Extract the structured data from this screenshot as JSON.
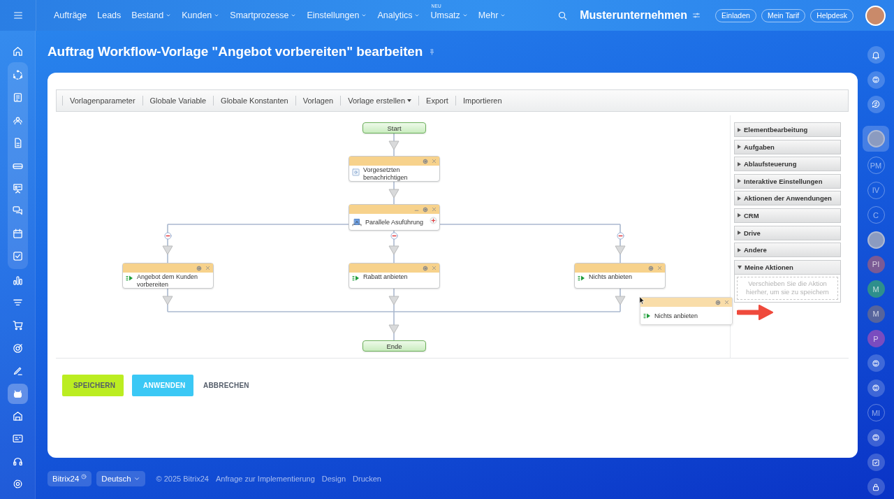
{
  "top_nav": {
    "items": [
      {
        "label": "Aufträge",
        "dropdown": false
      },
      {
        "label": "Leads",
        "dropdown": false
      },
      {
        "label": "Bestand",
        "dropdown": true
      },
      {
        "label": "Kunden",
        "dropdown": true
      },
      {
        "label": "Smartprozesse",
        "dropdown": true
      },
      {
        "label": "Einstellungen",
        "dropdown": true
      },
      {
        "label": "Analytics",
        "dropdown": true
      },
      {
        "label": "Umsatz",
        "dropdown": true,
        "badge": "NEU"
      },
      {
        "label": "Mehr",
        "dropdown": true
      }
    ],
    "company": "Musterunternehmen",
    "buttons": [
      "Einladen",
      "Mein Tarif",
      "Helpdesk"
    ]
  },
  "left_sidebar": {
    "items": [
      {
        "selected": false
      },
      {
        "selected": false
      },
      {
        "selected": false
      },
      {
        "selected": false
      },
      {
        "selected": false
      },
      {
        "selected": false
      },
      {
        "selected": false
      },
      {
        "selected": false
      },
      {
        "selected": false
      },
      {
        "selected": false
      },
      {
        "selected": false
      },
      {
        "selected": false
      },
      {
        "selected": false
      },
      {
        "selected": false
      },
      {
        "selected": false
      },
      {
        "selected": true
      },
      {
        "selected": false
      },
      {
        "selected": false
      },
      {
        "selected": false
      },
      {
        "selected": false
      }
    ]
  },
  "page_title": "Auftrag Workflow-Vorlage \"Angebot vorbereiten\" bearbeiten",
  "toolbar": [
    {
      "label": "Vorlagenparameter",
      "dropdown": false
    },
    {
      "label": "Globale Variable",
      "dropdown": false
    },
    {
      "label": "Globale Konstanten",
      "dropdown": false
    },
    {
      "label": "Vorlagen",
      "dropdown": false
    },
    {
      "label": "Vorlage erstellen",
      "dropdown": true
    },
    {
      "label": "Export",
      "dropdown": false
    },
    {
      "label": "Importieren",
      "dropdown": false
    }
  ],
  "diagram": {
    "nodes": [
      {
        "kind": "terminal",
        "label": "Start"
      },
      {
        "kind": "notify",
        "label": "Vorgesetzten benachrichtigen"
      },
      {
        "kind": "parallel",
        "label": "Parallele Asuführung"
      },
      {
        "kind": "action",
        "label": "Angebot dem Kunden vorbereiten"
      },
      {
        "kind": "action",
        "label": "Rabatt anbieten"
      },
      {
        "kind": "action",
        "label": "Nichts anbieten"
      },
      {
        "kind": "terminal",
        "label": "Ende"
      }
    ]
  },
  "palette": {
    "sections": [
      {
        "label": "Elementbearbeitung",
        "expanded": false
      },
      {
        "label": "Aufgaben",
        "expanded": false
      },
      {
        "label": "Ablaufsteuerung",
        "expanded": false
      },
      {
        "label": "Interaktive Einstellungen",
        "expanded": false
      },
      {
        "label": "Aktionen der Anwendungen",
        "expanded": false
      },
      {
        "label": "CRM",
        "expanded": false
      },
      {
        "label": "Drive",
        "expanded": false
      },
      {
        "label": "Andere",
        "expanded": false
      },
      {
        "label": "Meine Aktionen",
        "expanded": true,
        "hint": "Verschieben Sie die Aktion hierher, um sie zu speichern"
      }
    ]
  },
  "drag_item": {
    "label": "Nichts anbieten"
  },
  "buttons": [
    {
      "label": "SPEICHERN",
      "kind": "save"
    },
    {
      "label": "ANWENDEN",
      "kind": "apply"
    },
    {
      "label": "ABBRECHEN",
      "kind": "cancel"
    }
  ],
  "footer": {
    "brand": "Bitrix24",
    "language": "Deutsch",
    "links": [
      "© 2025 Bitrix24",
      "Anfrage zur Implementierung",
      "Design",
      "Drucken"
    ]
  },
  "right_sidebar": {
    "items": [
      {
        "kind": "icon",
        "selected": false
      },
      {
        "kind": "icon",
        "selected": false
      },
      {
        "kind": "icon",
        "selected": false
      },
      {
        "kind": "avatar",
        "selected": true
      },
      {
        "kind": "initials",
        "label": "PM",
        "selected": false
      },
      {
        "kind": "initials",
        "label": "IV",
        "selected": false
      },
      {
        "kind": "initials",
        "label": "C",
        "selected": false
      },
      {
        "kind": "avatar",
        "selected": false
      },
      {
        "kind": "initials",
        "label": "PI",
        "color": "#7b5a94",
        "selected": false
      },
      {
        "kind": "initials",
        "label": "M",
        "color": "#2e8f8c",
        "selected": false
      },
      {
        "kind": "initials",
        "label": "M",
        "color": "#56649c",
        "selected": false
      },
      {
        "kind": "initials",
        "label": "P",
        "color": "#7a4cbf",
        "selected": false
      },
      {
        "kind": "icon",
        "selected": false
      },
      {
        "kind": "icon",
        "selected": false
      },
      {
        "kind": "initials",
        "label": "MI",
        "selected": false
      },
      {
        "kind": "icon",
        "selected": false
      },
      {
        "kind": "icon",
        "selected": false
      },
      {
        "kind": "icon",
        "selected": false
      }
    ]
  }
}
